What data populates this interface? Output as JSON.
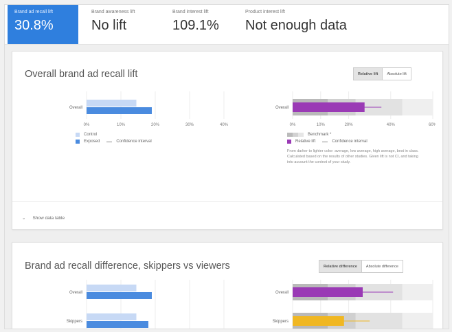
{
  "metrics": [
    {
      "label": "Brand ad recall lift",
      "value": "30.8%"
    },
    {
      "label": "Brand awareness lift",
      "value": "No lift"
    },
    {
      "label": "Brand interest lift",
      "value": "109.1%"
    },
    {
      "label": "Product interest lift",
      "value": "Not enough data"
    }
  ],
  "card1": {
    "title": "Overall brand ad recall lift",
    "toggle": {
      "selected": "Relative lift",
      "other": "Absolute lift"
    },
    "show_table": "Show data table",
    "legend_left": {
      "control": "Control",
      "exposed": "Exposed",
      "ci": "Confidence interval"
    },
    "legend_right": {
      "benchmark": "Benchmark *",
      "relative": "Relative lift",
      "ci": "Confidence interval"
    },
    "note": "From darker to lighter color: average, low average, high average, best in class. Calculated based on the results of other studies. Given lift is not CI, and taking into account the context of your study."
  },
  "card2": {
    "title": "Brand ad recall difference, skippers vs viewers",
    "toggle": {
      "selected": "Relative difference",
      "other": "Absolute difference"
    }
  },
  "colors": {
    "accent": "#2f7fde",
    "control": "#c7d9f5",
    "exposed": "#4a8bdf",
    "lift": "#9a3ab5",
    "skipper": "#f0b722"
  },
  "chart_data": [
    {
      "type": "bar",
      "title": "Overall brand ad recall lift",
      "categories": [
        "Overall"
      ],
      "series": [
        {
          "name": "Control",
          "values": [
            14.5
          ]
        },
        {
          "name": "Exposed",
          "values": [
            19
          ]
        }
      ],
      "x_ticks": [
        "0%",
        "10%",
        "20%",
        "30%",
        "40%"
      ],
      "xlim": [
        0,
        40
      ]
    },
    {
      "type": "bar",
      "categories": [
        "Overall"
      ],
      "series": [
        {
          "name": "Relative lift",
          "values": [
            30.8
          ]
        }
      ],
      "benchmark_bands": [
        15,
        27,
        47,
        60
      ],
      "ci": [
        [
          26,
          38
        ]
      ],
      "x_ticks": [
        "0%",
        "10%",
        "20%",
        "40%",
        "60%"
      ],
      "xlim": [
        0,
        60
      ]
    },
    {
      "type": "bar",
      "title": "Brand ad recall difference, skippers vs viewers",
      "categories": [
        "Overall",
        "Skippers"
      ],
      "series": [
        {
          "name": "Control",
          "values": [
            14.5,
            14.5
          ]
        },
        {
          "name": "Exposed",
          "values": [
            19,
            18
          ]
        }
      ]
    },
    {
      "type": "bar",
      "categories": [
        "Overall",
        "Skippers"
      ],
      "series": [
        {
          "name": "Relative difference",
          "values": [
            30,
            22
          ]
        }
      ],
      "ci": [
        [
          25,
          43
        ],
        [
          16,
          33
        ]
      ]
    }
  ]
}
